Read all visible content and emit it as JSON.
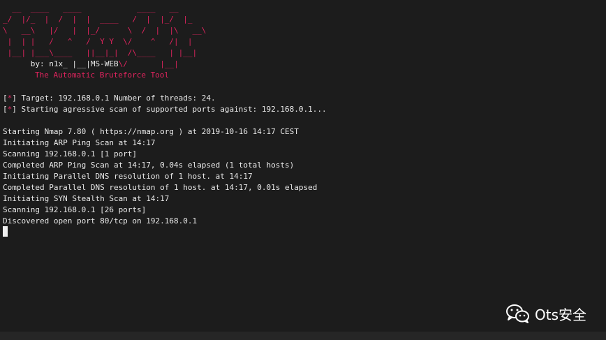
{
  "banner": {
    "art_lines": [
      "  __  ____   ____            ____   __",
      "_/  |/_  |  /  |  |  ____   /  |  |_/  |_",
      "\\   __\\   |/   |  |_/      \\  /  |  |\\   __\\",
      " |  | |   /   ^   /  Y Y  \\/    ^   /|  |",
      " |__| |___\\____   ||__|_|  /\\____   | |__|"
    ],
    "byline_prefix": "      by: n1x_ |__|",
    "byline_tool": "MS-WEB",
    "byline_suffix": "\\/       |__|",
    "tagline": "The Automatic Bruteforce Tool"
  },
  "status": {
    "open_bracket": "[",
    "star": "*",
    "close_bracket": "]",
    "line1": " Target: 192.168.0.1 Number of threads: 24.",
    "line2": " Starting agressive scan of supported ports against: 192.168.0.1..."
  },
  "nmap_output": [
    "Starting Nmap 7.80 ( https://nmap.org ) at 2019-10-16 14:17 CEST",
    "Initiating ARP Ping Scan at 14:17",
    "Scanning 192.168.0.1 [1 port]",
    "Completed ARP Ping Scan at 14:17, 0.04s elapsed (1 total hosts)",
    "Initiating Parallel DNS resolution of 1 host. at 14:17",
    "Completed Parallel DNS resolution of 1 host. at 14:17, 0.01s elapsed",
    "Initiating SYN Stealth Scan at 14:17",
    "Scanning 192.168.0.1 [26 ports]",
    "Discovered open port 80/tcp on 192.168.0.1"
  ],
  "watermark": {
    "icon": "wechat-icon",
    "text": "Ots安全"
  },
  "colors": {
    "background": "#1c1c1c",
    "text": "#e8e8e8",
    "accent_red": "#e0245e"
  }
}
